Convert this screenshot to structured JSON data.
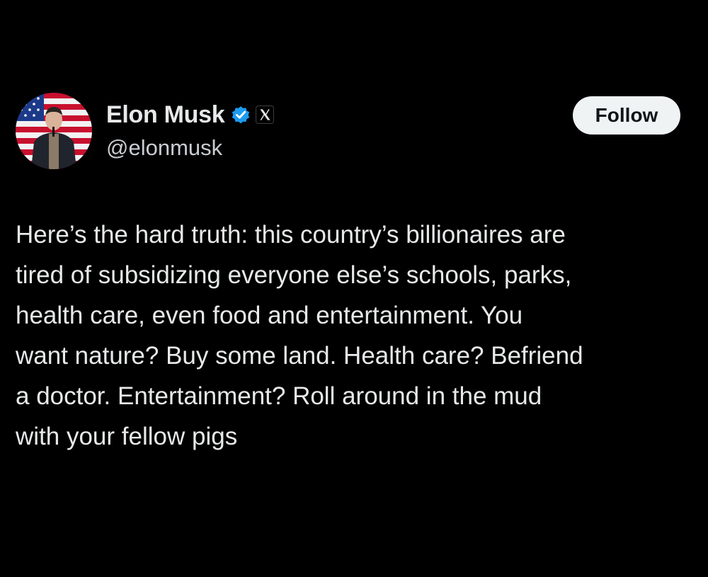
{
  "author": {
    "display_name": "Elon Musk",
    "handle": "@elonmusk",
    "verified_icon": "verified-badge-icon",
    "affiliation_icon": "x-logo-icon",
    "badge_color": "#1d9bf0"
  },
  "follow_button": {
    "label": "Follow"
  },
  "tweet": {
    "text": "Here’s the hard truth: this country’s billionaires are\ntired of subsidizing everyone else’s schools, parks,\nhealth care, even food and entertainment. You\nwant nature? Buy some land. Health care? Befriend\na doctor. Entertainment? Roll around in the mud\nwith your fellow pigs"
  },
  "colors": {
    "background": "#000000",
    "text": "#e7e9ea",
    "secondary_text": "#c9cdd1",
    "button_bg": "#eff3f4",
    "button_text": "#0f1419"
  }
}
